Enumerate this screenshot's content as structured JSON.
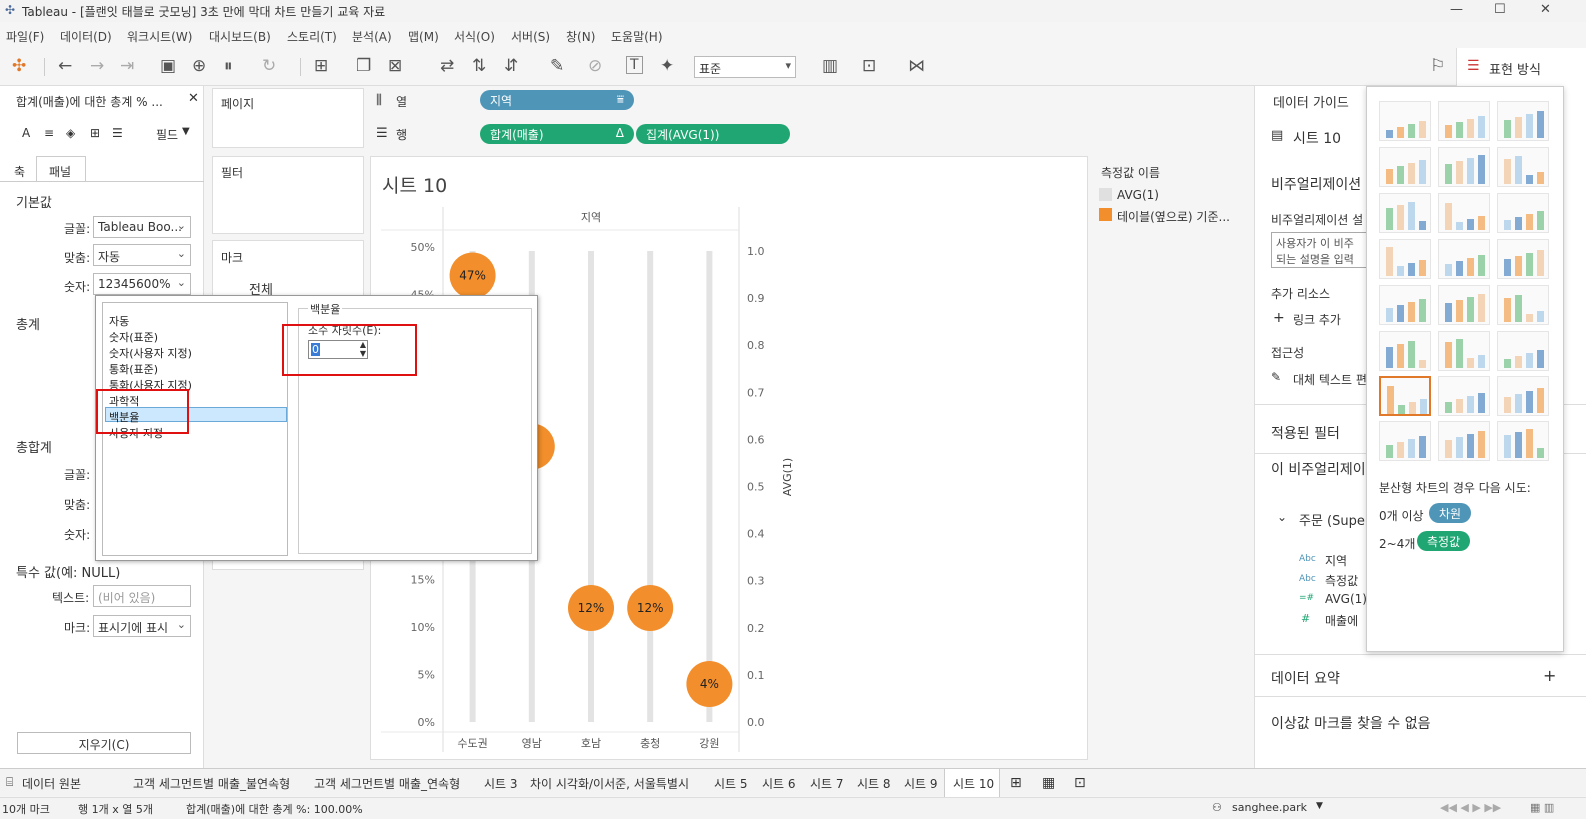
{
  "window": {
    "title": "Tableau - [플랜잇 태블로 굿모닝] 3초 만에 막대 차트 만들기 교육 자료",
    "minimize": "—",
    "maximize": "☐",
    "close": "✕"
  },
  "menu": [
    "파일(F)",
    "데이터(D)",
    "워크시트(W)",
    "대시보드(B)",
    "스토리(T)",
    "분석(A)",
    "맵(M)",
    "서식(O)",
    "서버(S)",
    "창(N)",
    "도움말(H)"
  ],
  "toolbar": {
    "fit_select": "표준",
    "show_me_label": "표현 방식"
  },
  "left_panel": {
    "header": "합계(매출)에 대한 총계 % ...",
    "fields_label": "필드",
    "tabs": [
      "축",
      "패널"
    ],
    "section_default": "기본값",
    "font_label": "글꼴:",
    "font_value": "Tableau Boo...",
    "align_label": "맞춤:",
    "align_value": "자동",
    "number_label": "숫자:",
    "number_value": "12345600%",
    "section_totals": "총계",
    "section_grand": "총합계",
    "special_label": "특수 값(예: NULL)",
    "text_label": "텍스트:",
    "text_placeholder": "(비어 있음)",
    "marks_label": "마크:",
    "marks_value": "표시기에 표시",
    "clear_button": "지우기(C)"
  },
  "shelves": {
    "pages": "페이지",
    "filters": "필터",
    "marks": "마크",
    "marks_all": "전체",
    "columns_label": "열",
    "rows_label": "행",
    "columns_pill": "지역",
    "rows_pill_1": "합계(매출)",
    "rows_pill_1_delta": "Δ",
    "rows_pill_2": "집계(AVG(1))"
  },
  "format_dialog": {
    "options": [
      "자동",
      "숫자(표준)",
      "숫자(사용자 지정)",
      "통화(표준)",
      "통화(사용자 지정)",
      "과학적",
      "백분율",
      "사용자 지정"
    ],
    "selected": "백분율",
    "group_title": "백분율",
    "decimal_label": "소수 자릿수(E):",
    "decimal_value": "0"
  },
  "sheet": {
    "title": "시트 10",
    "header_label": "지역"
  },
  "legend": {
    "title": "측정값 이름",
    "items": [
      {
        "label": "AVG(1)",
        "color": "#e0e0e0"
      },
      {
        "label": "테이블(옆으로) 기준...",
        "color": "#f28e2b"
      }
    ]
  },
  "chart_data": {
    "type": "scatter",
    "categories": [
      "수도권",
      "영남",
      "호남",
      "충청",
      "강원"
    ],
    "values": [
      47,
      29,
      12,
      12,
      4
    ],
    "labels": [
      "47%",
      "",
      "12%",
      "12%",
      "4%"
    ],
    "left_ticks": [
      "50%",
      "45%",
      "15%",
      "10%",
      "5%",
      "0%"
    ],
    "right_ticks": [
      "1.0",
      "0.9",
      "0.8",
      "0.7",
      "0.6",
      "0.5",
      "0.4",
      "0.3",
      "0.2",
      "0.1",
      "0.0"
    ],
    "right_axis_label": "AVG(1)",
    "x_header": "지역",
    "ylim": [
      0,
      50
    ],
    "bar_color": "#e3e3e3",
    "mark_color": "#f28e2b"
  },
  "data_guide": {
    "title": "데이터 가이드",
    "sheet": "시트 10",
    "viz_desc_title": "비주얼리제이션",
    "viz_desc_sub": "비주얼리제이션 설",
    "desc_placeholder_1": "사용자가 이 비주",
    "desc_placeholder_2": "되는 설명을 입력",
    "resources": "추가 리소스",
    "add_link": "링크 추가",
    "accessibility": "접근성",
    "alt_text": "대체 텍스트 편",
    "applied_filters": "적용된 필터",
    "this_viz": "이 비주얼리제이",
    "source": "주문 (Supe",
    "fields": [
      {
        "type": "Abc",
        "name": "지역"
      },
      {
        "type": "Abc",
        "name": "측정값"
      },
      {
        "type": "=#",
        "name": "AVG(1)"
      },
      {
        "type": "#",
        "name": "매출에"
      }
    ],
    "data_summary": "데이터 요약",
    "outliers": "이상값 마크를 찾을 수 없음"
  },
  "show_me": {
    "hint": "분산형 차트의 경우 다음 시도:",
    "row1_prefix": "0개 이상",
    "row1_badge": "차원",
    "row2_prefix": "2~4개",
    "row2_badge": "측정값",
    "dim_color": "#4e95b7",
    "measure_color": "#1fa672"
  },
  "tabs": [
    "데이터 원본",
    "고객 세그먼트별 매출_불연속형",
    "고객 세그먼트별 매출_연속형",
    "시트 3",
    "차이 시각화/이서준, 서울특별시",
    "시트 5",
    "시트 6",
    "시트 7",
    "시트 8",
    "시트 9",
    "시트 10"
  ],
  "status": {
    "marks": "10개 마크",
    "dims": "행 1개 x 열 5개",
    "sum": "합계(매출)에 대한 총계 %: 100.00%",
    "user": "sanghee.park"
  }
}
